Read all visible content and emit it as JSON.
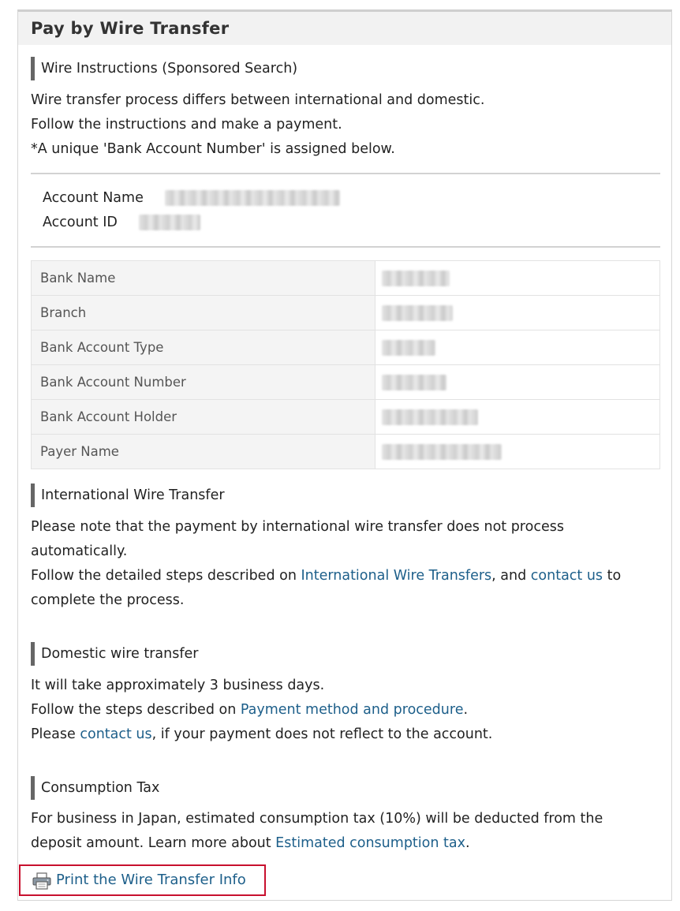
{
  "header": {
    "title": "Pay by Wire Transfer"
  },
  "instructions": {
    "heading": "Wire Instructions (Sponsored Search)",
    "lines": [
      "Wire transfer process differs between international and domestic.",
      "Follow the instructions and make a payment.",
      "*A unique 'Bank Account Number' is assigned below."
    ]
  },
  "account": {
    "name_label": "Account Name",
    "id_label": "Account ID"
  },
  "bank_table": {
    "rows": [
      {
        "label": "Bank Name"
      },
      {
        "label": "Branch"
      },
      {
        "label": "Bank Account Type"
      },
      {
        "label": "Bank Account Number"
      },
      {
        "label": "Bank Account Holder"
      },
      {
        "label": "Payer Name"
      }
    ]
  },
  "international": {
    "heading": "International Wire Transfer",
    "line1": "Please note that the payment by international wire transfer does not process",
    "line2": "automatically.",
    "line3_prefix": "Follow the detailed steps described on ",
    "line3_link1": "International Wire Transfers",
    "line3_mid": ", and ",
    "line3_link2": "contact us",
    "line3_suffix": " to",
    "line4": "complete the process."
  },
  "domestic": {
    "heading": "Domestic wire transfer",
    "line1": "It will take approximately 3 business days.",
    "line2_prefix": "Follow the steps described on ",
    "line2_link": "Payment method and procedure",
    "line2_suffix": ".",
    "line3_prefix": "Please ",
    "line3_link": "contact us",
    "line3_suffix": ", if your payment does not reflect to the account."
  },
  "tax": {
    "heading": "Consumption Tax",
    "line1": "For business in Japan, estimated consumption tax (10%) will be deducted from the",
    "line2_prefix": "deposit amount. Learn more about ",
    "line2_link": "Estimated consumption tax",
    "line2_suffix": "."
  },
  "print": {
    "label": "Print the Wire Transfer Info",
    "icon": "printer-icon"
  },
  "colors": {
    "link": "#1d5f8a",
    "highlight_border": "#c8102e",
    "heading_bar": "#666666"
  }
}
